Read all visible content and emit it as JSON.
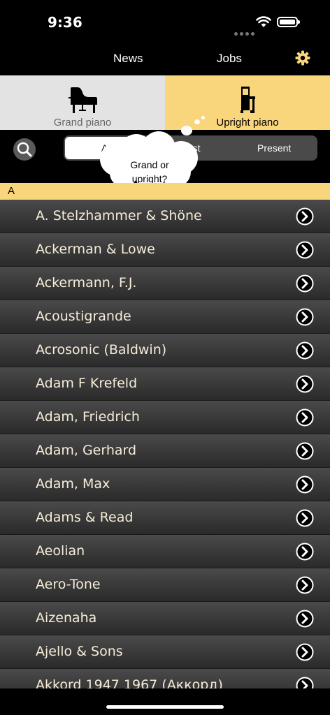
{
  "status": {
    "time": "9:36"
  },
  "nav": {
    "news": "News",
    "jobs": "Jobs"
  },
  "piano_type": {
    "grand": "Grand piano",
    "upright": "Upright piano"
  },
  "filter": {
    "options": [
      "All",
      "Past",
      "Present"
    ],
    "selected": "All"
  },
  "bubble": {
    "line1": "Grand or",
    "line2": "upright?"
  },
  "section": "A",
  "items": [
    "A. Stelzhammer & Shöne",
    "Ackerman & Lowe",
    "Ackermann, F.J.",
    "Acoustigrande",
    "Acrosonic (Baldwin)",
    "Adam F Krefeld",
    "Adam, Friedrich",
    "Adam, Gerhard",
    "Adam, Max",
    "Adams & Read",
    "Aeolian",
    "Aero-Tone",
    "Aizenaha",
    "Ajello & Sons",
    "Akkord 1947 1967 (Аккорд)"
  ],
  "colors": {
    "accent": "#f9d57b",
    "list_text": "#f7ecd9",
    "grand_bg": "#e3e3e3"
  }
}
